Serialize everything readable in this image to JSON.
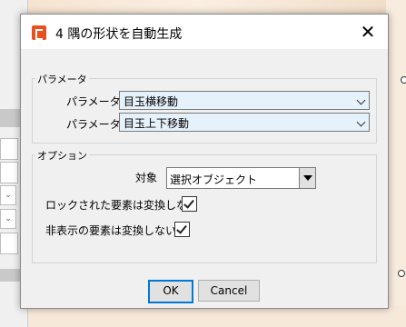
{
  "dialog": {
    "title": "4 隅の形状を自動生成",
    "close_symbol": "✕"
  },
  "params_group": {
    "label": "パラメータ",
    "param1_label": "パラメータ1",
    "param1_value": "目玉横移動",
    "param2_label": "パラメータ2",
    "param2_value": "目玉上下移動"
  },
  "options_group": {
    "label": "オプション",
    "target_label": "対象",
    "target_value": "選択オブジェクト",
    "locked_label": "ロックされた要素は変換しない",
    "locked_checked": true,
    "hidden_label": "非表示の要素は変換しない",
    "hidden_checked": true
  },
  "buttons": {
    "ok": "OK",
    "cancel": "Cancel"
  },
  "icons": {
    "app": "app-logo-icon",
    "close": "close-icon",
    "combo_arrow": "chevron-down-icon",
    "select_arrow": "triangle-down-icon",
    "check": "checkmark-icon"
  },
  "colors": {
    "app_icon": "#e8501e",
    "focus": "#0078d7",
    "combo_bg": "#e5f1fb"
  }
}
